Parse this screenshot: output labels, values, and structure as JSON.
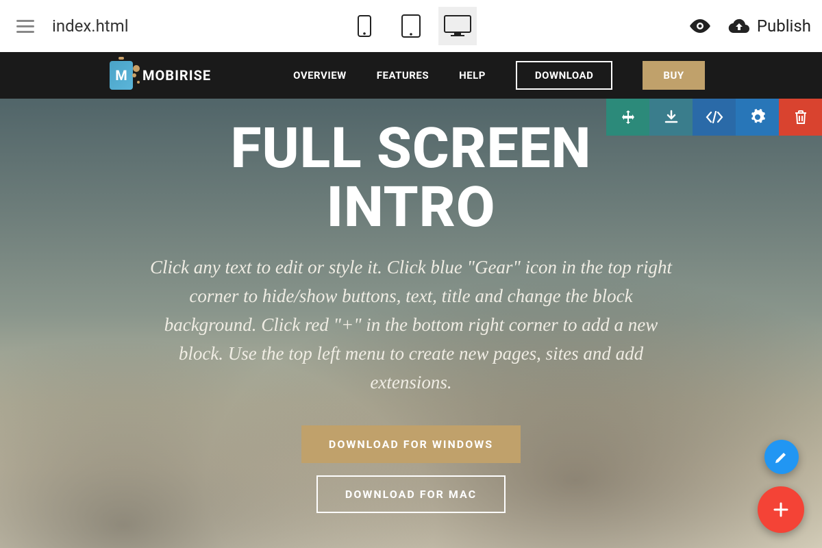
{
  "appBar": {
    "filename": "index.html",
    "publish_label": "Publish"
  },
  "siteNav": {
    "brand": "MOBIRISE",
    "brand_letter": "M",
    "links": [
      "OVERVIEW",
      "FEATURES",
      "HELP"
    ],
    "download_label": "DOWNLOAD",
    "buy_label": "BUY"
  },
  "hero": {
    "title_line1": "FULL SCREEN",
    "title_line2": "INTRO",
    "description": "Click any text to edit or style it. Click blue \"Gear\" icon in the top right corner to hide/show buttons, text, title and change the block background. Click red \"+\" in the bottom right corner to add a new block. Use the top left menu to create new pages, sites and add extensions.",
    "btn_windows": "DOWNLOAD FOR WINDOWS",
    "btn_mac": "DOWNLOAD FOR MAC"
  },
  "blockToolbar": {
    "icons": [
      "move-icon",
      "save-icon",
      "code-icon",
      "gear-icon",
      "delete-icon"
    ]
  }
}
